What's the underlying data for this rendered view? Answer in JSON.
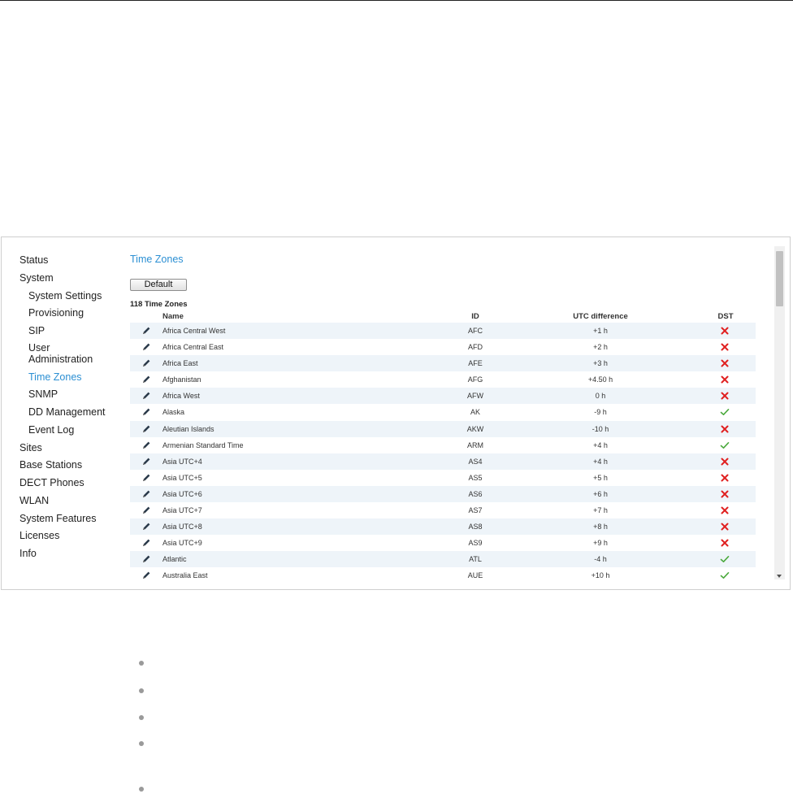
{
  "sidebar": {
    "items": [
      {
        "label": "Status",
        "active": false
      },
      {
        "label": "System",
        "active": false
      },
      {
        "label": "System Settings",
        "active": false
      },
      {
        "label": "Provisioning",
        "active": false
      },
      {
        "label": "SIP",
        "active": false
      },
      {
        "label": "User Administration",
        "active": false
      },
      {
        "label": "Time Zones",
        "active": true
      },
      {
        "label": "SNMP",
        "active": false
      },
      {
        "label": "DD Management",
        "active": false
      },
      {
        "label": "Event Log",
        "active": false
      },
      {
        "label": "Sites",
        "active": false
      },
      {
        "label": "Base Stations",
        "active": false
      },
      {
        "label": "DECT Phones",
        "active": false
      },
      {
        "label": "WLAN",
        "active": false
      },
      {
        "label": "System Features",
        "active": false
      },
      {
        "label": "Licenses",
        "active": false
      },
      {
        "label": "Info",
        "active": false
      }
    ]
  },
  "main": {
    "title": "Time Zones",
    "default_button_label": "Default",
    "count_label": "118 Time Zones",
    "columns": {
      "name": "Name",
      "id": "ID",
      "utc": "UTC difference",
      "dst": "DST"
    },
    "rows": [
      {
        "name": "Africa Central West",
        "id": "AFC",
        "utc": "+1 h",
        "dst": false
      },
      {
        "name": "Africa Central East",
        "id": "AFD",
        "utc": "+2 h",
        "dst": false
      },
      {
        "name": "Africa East",
        "id": "AFE",
        "utc": "+3 h",
        "dst": false
      },
      {
        "name": "Afghanistan",
        "id": "AFG",
        "utc": "+4.50 h",
        "dst": false
      },
      {
        "name": "Africa West",
        "id": "AFW",
        "utc": "0 h",
        "dst": false
      },
      {
        "name": "Alaska",
        "id": "AK",
        "utc": "-9 h",
        "dst": true
      },
      {
        "name": "Aleutian Islands",
        "id": "AKW",
        "utc": "-10 h",
        "dst": false
      },
      {
        "name": "Armenian Standard Time",
        "id": "ARM",
        "utc": "+4 h",
        "dst": true
      },
      {
        "name": "Asia UTC+4",
        "id": "AS4",
        "utc": "+4 h",
        "dst": false
      },
      {
        "name": "Asia UTC+5",
        "id": "AS5",
        "utc": "+5 h",
        "dst": false
      },
      {
        "name": "Asia UTC+6",
        "id": "AS6",
        "utc": "+6 h",
        "dst": false
      },
      {
        "name": "Asia UTC+7",
        "id": "AS7",
        "utc": "+7 h",
        "dst": false
      },
      {
        "name": "Asia UTC+8",
        "id": "AS8",
        "utc": "+8 h",
        "dst": false
      },
      {
        "name": "Asia UTC+9",
        "id": "AS9",
        "utc": "+9 h",
        "dst": false
      },
      {
        "name": "Atlantic",
        "id": "ATL",
        "utc": "-4 h",
        "dst": true
      },
      {
        "name": "Australia East",
        "id": "AUE",
        "utc": "+10 h",
        "dst": true
      }
    ]
  },
  "icons": {
    "edit": "pencil-icon",
    "dst_on": "check-icon",
    "dst_off": "cross-icon"
  },
  "colors": {
    "accent": "#2b8fd3",
    "row_alt": "#eef4f9",
    "check": "#4caa3e",
    "cross": "#e02020",
    "pencil": "#2a3a4a"
  }
}
